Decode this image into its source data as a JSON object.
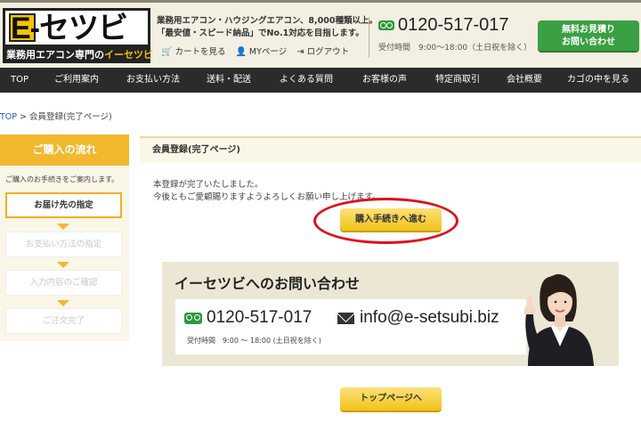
{
  "header": {
    "logo_text": "E-セツビ",
    "logo_sub_prefix": "業務用エアコン専門の",
    "logo_sub_accent": "イーセツビ",
    "tagline_line1": "業務用エアコン・ハウジングエアコン、8,000種類以上。",
    "tagline_line2": "「最安値・スピード納品」でNo.1対応を目指します。",
    "links": [
      {
        "icon": "cart-icon",
        "label": "カートを見る"
      },
      {
        "icon": "user-icon",
        "label": "MYページ"
      },
      {
        "icon": "logout-icon",
        "label": "ログアウト"
      }
    ],
    "phone": "0120-517-017",
    "hours": "受付時間　9:00～18:00（土日祝を除く）",
    "quote_button_line1": "無料お見積り",
    "quote_button_line2": "お問い合わせ"
  },
  "nav": {
    "items": [
      "TOP",
      "ご利用案内",
      "お支払い方法",
      "送料・配送",
      "よくある質問",
      "お客様の声",
      "特定商取引",
      "会社概要",
      "カゴの中を見る"
    ]
  },
  "breadcrumb": {
    "home": "TOP",
    "separator": " > ",
    "current": "会員登録(完了ページ)"
  },
  "sidebar": {
    "title": "ご購入の流れ",
    "description": "ご購入のお手続きをご案内します。",
    "steps": [
      "お届け先の指定",
      "お支払い方法の指定",
      "入力内容のご確認",
      "ご注文完了"
    ]
  },
  "main": {
    "heading": "会員登録(完了ページ)",
    "message_line1": "本登録が完了いたしました。",
    "message_line2": "今後ともご愛顧賜りますようよろしくお願い申し上げます。",
    "proceed_button": "購入手続きへ進む",
    "top_button": "トップページへ"
  },
  "contact": {
    "title": "イーセツビへのお問い合わせ",
    "phone": "0120-517-017",
    "email": "info@e-setsubi.biz",
    "hours": "受付時間　9:00 〜 18:00 (土日祝を除く)"
  },
  "colors": {
    "accent_yellow": "#f3b82e",
    "brand_green": "#3aa043",
    "nav_dark": "#2b2b2b",
    "highlight_red": "#e0101a"
  }
}
